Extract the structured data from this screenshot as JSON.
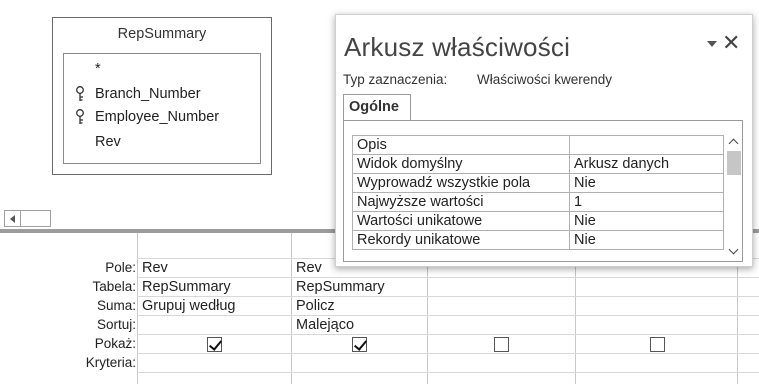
{
  "table": {
    "name": "RepSummary",
    "fields": [
      {
        "name": "*",
        "key": false
      },
      {
        "name": "Branch_Number",
        "key": true
      },
      {
        "name": "Employee_Number",
        "key": true
      },
      {
        "name": "Rev",
        "key": false
      }
    ]
  },
  "grid": {
    "row_labels": [
      "Pole:",
      "Tabela:",
      "Suma:",
      "Sortuj:",
      "Pokaż:",
      "Kryteria:"
    ],
    "columns": [
      {
        "field": "Rev",
        "table": "RepSummary",
        "total": "Grupuj według",
        "sort": "",
        "show": true
      },
      {
        "field": "Rev",
        "table": "RepSummary",
        "total": "Policz",
        "sort": "Malejąco",
        "show": true
      },
      {
        "field": "",
        "table": "",
        "total": "",
        "sort": "",
        "show": false
      },
      {
        "field": "",
        "table": "",
        "total": "",
        "sort": "",
        "show": false
      }
    ]
  },
  "property_sheet": {
    "title": "Arkusz właściwości",
    "close_glyph": "✕",
    "selection_label": "Typ zaznaczenia:",
    "selection_value": "Właściwości kwerendy",
    "tab": "Ogólne",
    "properties": [
      {
        "name": "Opis",
        "value": ""
      },
      {
        "name": "Widok domyślny",
        "value": "Arkusz danych"
      },
      {
        "name": "Wyprowadź wszystkie pola",
        "value": "Nie"
      },
      {
        "name": "Najwyższe wartości",
        "value": "1"
      },
      {
        "name": "Wartości unikatowe",
        "value": "Nie"
      },
      {
        "name": "Rekordy unikatowe",
        "value": "Nie"
      }
    ]
  },
  "icons": {
    "key": "primary-key-icon",
    "checkbox_checked": "checkbox-checked-icon",
    "checkbox_empty": "checkbox-empty-icon",
    "close": "close-icon",
    "menu": "dropdown-menu-icon"
  },
  "colors": {
    "background": "#ffffff",
    "border": "#6a6a6a",
    "splitter": "#9c9c9c",
    "text": "#222222"
  }
}
